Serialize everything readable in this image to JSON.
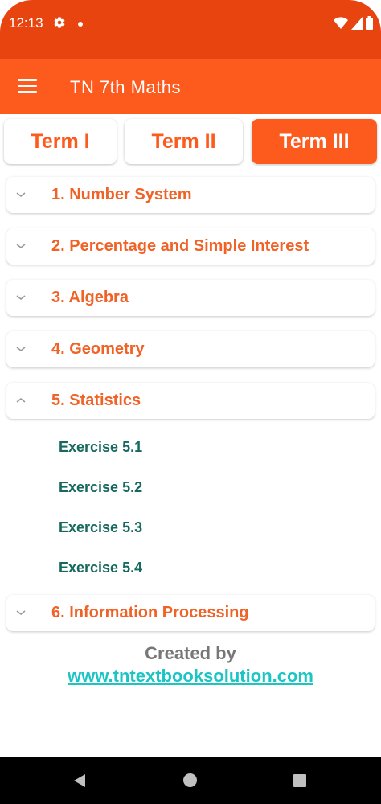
{
  "status_bar": {
    "time": "12:13",
    "icons": [
      "gear-icon",
      "notification-dot-icon",
      "wifi-icon",
      "cell-signal-icon",
      "battery-icon"
    ]
  },
  "app_bar": {
    "title": "TN 7th Maths",
    "menu_icon": "hamburger-menu-icon"
  },
  "tabs": [
    {
      "label": "Term I",
      "active": false
    },
    {
      "label": "Term II",
      "active": false
    },
    {
      "label": "Term III",
      "active": true
    }
  ],
  "chapters": [
    {
      "title": "1. Number System",
      "expanded": false
    },
    {
      "title": "2. Percentage and Simple Interest",
      "expanded": false
    },
    {
      "title": "3. Algebra",
      "expanded": false
    },
    {
      "title": "4. Geometry",
      "expanded": false
    },
    {
      "title": "5. Statistics",
      "expanded": true,
      "exercises": [
        "Exercise 5.1",
        "Exercise 5.2",
        "Exercise 5.3",
        "Exercise 5.4"
      ]
    },
    {
      "title": "6. Information Processing",
      "expanded": false
    }
  ],
  "footer": {
    "created_by": "Created by",
    "link": "www.tntextbooksolution.com"
  },
  "nav_bar": {
    "icons": [
      "back-icon",
      "home-icon",
      "recents-icon"
    ]
  },
  "colors": {
    "status_bar": "#e84410",
    "app_bar": "#fd5a1e",
    "accent": "#fd5a1e",
    "chapter_text": "#f06226",
    "exercise_text": "#17695f",
    "link": "#1cc5c4"
  }
}
